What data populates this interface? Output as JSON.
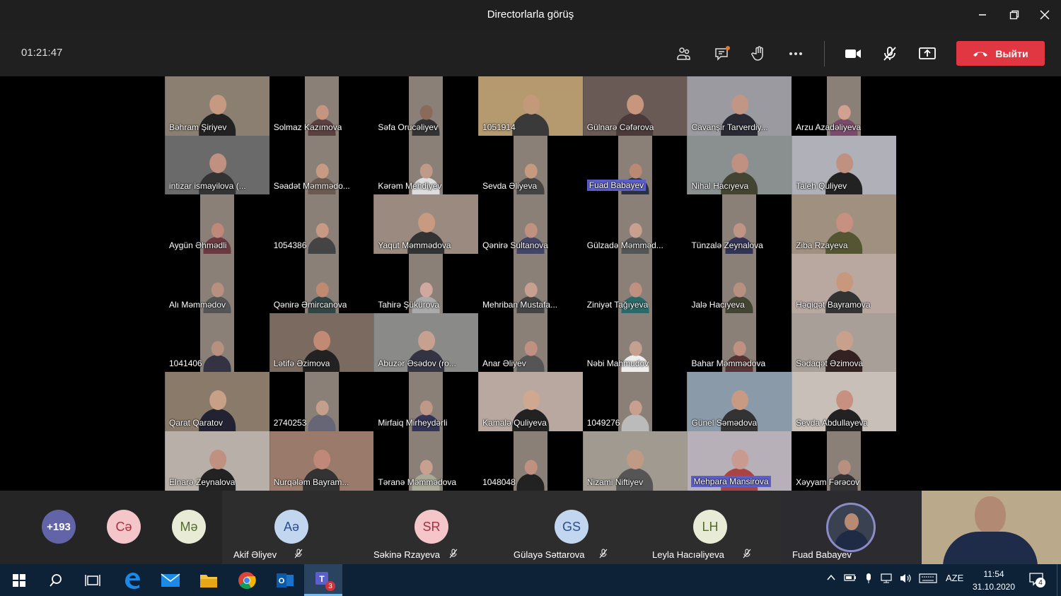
{
  "window": {
    "title": "Directorlarla görüş"
  },
  "toolbar": {
    "timer": "01:21:47",
    "leave_label": "Выйти"
  },
  "grid": [
    {
      "name": "Bəhram Şiriyev",
      "bg": "#8a7f70",
      "skin": "#c59a80",
      "shirt": "#222"
    },
    {
      "name": "Solmaz Kazımova",
      "bg": "#000",
      "skin": "#c49580",
      "shirt": "#5a4040"
    },
    {
      "name": "Səfa Orucəliyev",
      "bg": "#000",
      "skin": "#8a6a5a",
      "shirt": "#333"
    },
    {
      "name": "1051914",
      "bg": "#b59a70",
      "skin": "#c29a7a",
      "shirt": "#3a3a3a"
    },
    {
      "name": "Gülnarə Cəfərova",
      "bg": "#6a5a55",
      "skin": "#c8967c",
      "shirt": "#4a3a3a"
    },
    {
      "name": "Cavanşir Tarverdiy...",
      "bg": "#9a9aa0",
      "skin": "#c29684",
      "shirt": "#2a2a35"
    },
    {
      "name": "Arzu Azadəliyeva",
      "bg": "#000",
      "skin": "#d0a090",
      "shirt": "#7a4a6a"
    },
    {
      "name": "intizar ismayilova (...",
      "bg": "#6a6a6a",
      "skin": "#c09080",
      "shirt": "#333"
    },
    {
      "name": "Səadət Məmmədo...",
      "bg": "#000",
      "skin": "#c79a84",
      "shirt": "#6a5a50"
    },
    {
      "name": "Kərəm Mehdiyev",
      "bg": "#000",
      "skin": "#c09a88",
      "shirt": "#ddd"
    },
    {
      "name": "Sevda Əliyeva",
      "bg": "#000",
      "skin": "#c49a80",
      "shirt": "#444"
    },
    {
      "name": "Fuad Babayev",
      "bg": "#000",
      "skin": "#b88a74",
      "shirt": "#2a3040",
      "hl": true
    },
    {
      "name": "Nihal Hacıyeva",
      "bg": "#8a9090",
      "skin": "#c09080",
      "shirt": "#443"
    },
    {
      "name": "Taleh Quliyev",
      "bg": "#b0b0b8",
      "skin": "#c09080",
      "shirt": "#222"
    },
    {
      "name": "Aygün Əhmədli",
      "bg": "#000",
      "skin": "#c08878",
      "shirt": "#6a3a40"
    },
    {
      "name": "1054386",
      "bg": "#000",
      "skin": "#c89a84",
      "shirt": "#444"
    },
    {
      "name": "Yaqut Məmmədova",
      "bg": "#9a8a80",
      "skin": "#c89a80",
      "shirt": "#333"
    },
    {
      "name": "Qənirə Sultanova",
      "bg": "#000",
      "skin": "#c09080",
      "shirt": "#446"
    },
    {
      "name": "Gülzadə Məmməd...",
      "bg": "#000",
      "skin": "#c8a090",
      "shirt": "#555"
    },
    {
      "name": "Tünzalə Zeynalova",
      "bg": "#000",
      "skin": "#c09484",
      "shirt": "#335"
    },
    {
      "name": "Ziba Rzayeva",
      "bg": "#a09080",
      "skin": "#c89080",
      "shirt": "#553"
    },
    {
      "name": "Alı Məmmədov",
      "bg": "#000",
      "skin": "#b89080",
      "shirt": "#555"
    },
    {
      "name": "Qənirə Əmircanova",
      "bg": "#000",
      "skin": "#c08a70",
      "shirt": "#344"
    },
    {
      "name": "Tahirə Şükürova",
      "bg": "#000",
      "skin": "#d0a8a0",
      "shirt": "#aaa"
    },
    {
      "name": "Mehriban Mustafa...",
      "bg": "#000",
      "skin": "#c8a090",
      "shirt": "#444"
    },
    {
      "name": "Ziniyət Tağıyeva",
      "bg": "#000",
      "skin": "#c09080",
      "shirt": "#2a6a6a"
    },
    {
      "name": "Jalə Hacıyeva",
      "bg": "#000",
      "skin": "#b89080",
      "shirt": "#443"
    },
    {
      "name": "Həqiqət Bayramova",
      "bg": "#b8a8a0",
      "skin": "#c8987c",
      "shirt": "#333"
    },
    {
      "name": "1041406",
      "bg": "#000",
      "skin": "#b89080",
      "shirt": "#334"
    },
    {
      "name": "Lətifə Əzimova",
      "bg": "#7a6a60",
      "skin": "#c08a74",
      "shirt": "#222"
    },
    {
      "name": "Abuzər Əsədov (ro...",
      "bg": "#8a8a88",
      "skin": "#c8a090",
      "shirt": "#334"
    },
    {
      "name": "Anar Əliyev",
      "bg": "#000",
      "skin": "#c09080",
      "shirt": "#555"
    },
    {
      "name": "Nəbi Mahmudov",
      "bg": "#000",
      "skin": "#c4a090",
      "shirt": "#eee"
    },
    {
      "name": "Bahar Məmmədova",
      "bg": "#000",
      "skin": "#c09080",
      "shirt": "#533"
    },
    {
      "name": "Sədaqət Əzimova",
      "bg": "#a8a098",
      "skin": "#c8a08c",
      "shirt": "#322"
    },
    {
      "name": "Qarat Qaratov",
      "bg": "#8a7a6a",
      "skin": "#c8a088",
      "shirt": "#223"
    },
    {
      "name": "2740253",
      "bg": "#000",
      "skin": "#c4a08c",
      "shirt": "#667"
    },
    {
      "name": "Mirfaiq Mirheydərli",
      "bg": "#000",
      "skin": "#c09888",
      "shirt": "#335"
    },
    {
      "name": "Kamalə Quliyeva",
      "bg": "#b8a8a0",
      "skin": "#d0a890",
      "shirt": "#222"
    },
    {
      "name": "1049276",
      "bg": "#000",
      "skin": "#c8a090",
      "shirt": "#bbb"
    },
    {
      "name": "Günel Səmədova",
      "bg": "#8a9aa8",
      "skin": "#c89a84",
      "shirt": "#333"
    },
    {
      "name": "Sevda Abdullayeva",
      "bg": "#c8c0b8",
      "skin": "#c89080",
      "shirt": "#222"
    },
    {
      "name": "Elnarə Zeynalova",
      "bg": "#b8b0a8",
      "skin": "#c09080",
      "shirt": "#222"
    },
    {
      "name": "Nurqələm Bayram...",
      "bg": "#9a7a6a",
      "skin": "#c08878",
      "shirt": "#333"
    },
    {
      "name": "Təranə Məmmədova",
      "bg": "#000",
      "skin": "#c8a090",
      "shirt": "#aa9"
    },
    {
      "name": "1048048",
      "bg": "#000",
      "skin": "#c09080",
      "shirt": "#222"
    },
    {
      "name": "Nizami Niftiyev",
      "bg": "#a09a90",
      "skin": "#c09a84",
      "shirt": "#555"
    },
    {
      "name": "Mehpara Mansirova",
      "bg": "#b8b0b8",
      "skin": "#c89a90",
      "shirt": "#a44",
      "hl": true
    },
    {
      "name": "Xəyyam Fərəcov",
      "bg": "#000",
      "skin": "#b89080",
      "shirt": "#333"
    }
  ],
  "strip": {
    "overflow_count": "+193",
    "small_avatars": [
      {
        "initials": "Cə",
        "bg": "#f4c5c9",
        "fg": "#a2323e"
      },
      {
        "initials": "Mə",
        "bg": "#e8ecd6",
        "fg": "#556b2f"
      }
    ],
    "participants": [
      {
        "initials": "Aə",
        "name": "Akif Əliyev",
        "bg": "#c3d6f0",
        "fg": "#2a4e8a"
      },
      {
        "initials": "SR",
        "name": "Səkinə Rzayeva",
        "bg": "#f4c5c9",
        "fg": "#a2323e"
      },
      {
        "initials": "GS",
        "name": "Gülayə Səttarova",
        "bg": "#c3d6f0",
        "fg": "#2a4e8a"
      },
      {
        "initials": "LH",
        "name": "Leyla Hacıəliyeva",
        "bg": "#e8ecd6",
        "fg": "#556b2f"
      }
    ],
    "active_speaker": "Fuad Babayev"
  },
  "taskbar": {
    "language": "AZE",
    "time": "11:54",
    "date": "31.10.2020",
    "teams_badge": "3",
    "notif_badge": "4"
  }
}
